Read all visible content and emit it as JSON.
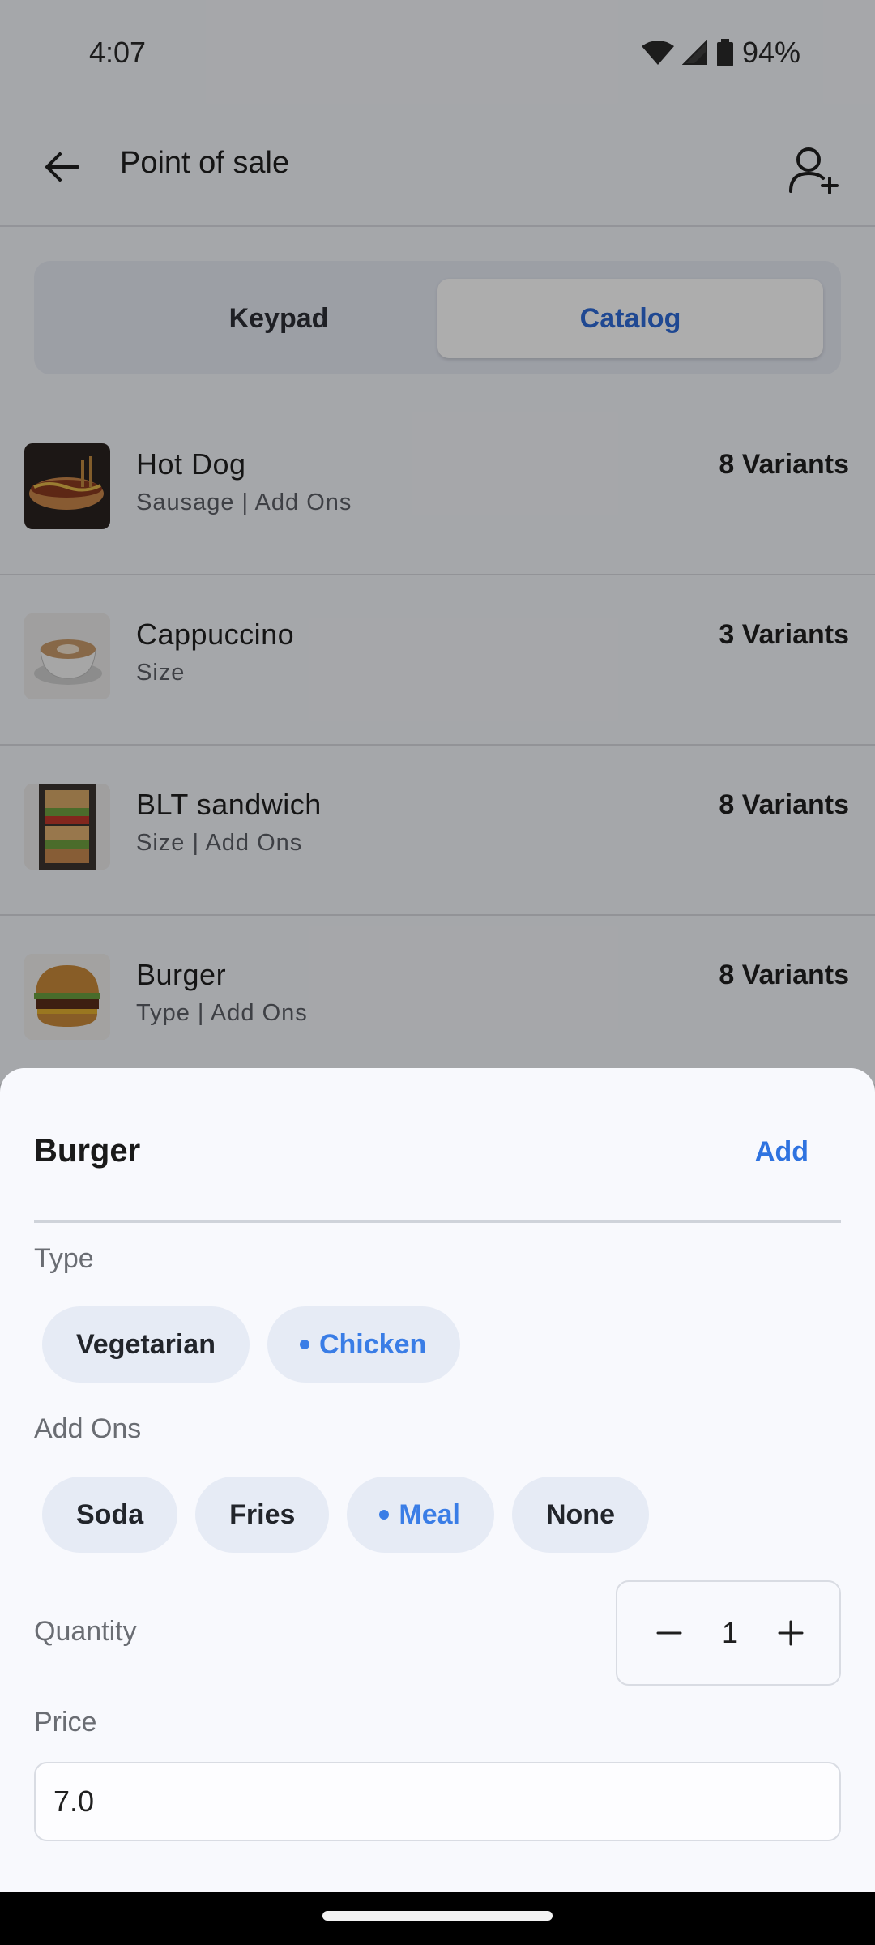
{
  "status_bar": {
    "time": "4:07",
    "battery": "94%"
  },
  "app_bar": {
    "title": "Point of sale"
  },
  "segmented": {
    "keypad_label": "Keypad",
    "catalog_label": "Catalog",
    "selected": "Catalog"
  },
  "catalog": {
    "items": [
      {
        "name": "Hot Dog",
        "subtitle": "Sausage | Add Ons",
        "variants": "8 Variants",
        "icon": "hot-dog-image"
      },
      {
        "name": "Cappuccino",
        "subtitle": "Size",
        "variants": "3 Variants",
        "icon": "cappuccino-image"
      },
      {
        "name": "BLT sandwich",
        "subtitle": "Size | Add Ons",
        "variants": "8 Variants",
        "icon": "sandwich-image"
      },
      {
        "name": "Burger",
        "subtitle": "Type | Add Ons",
        "variants": "8 Variants",
        "icon": "burger-image"
      }
    ]
  },
  "sheet": {
    "title": "Burger",
    "add_label": "Add",
    "type_label": "Type",
    "type_options": [
      "Vegetarian",
      "Chicken"
    ],
    "type_selected": "Chicken",
    "addons_label": "Add Ons",
    "addon_options": [
      "Soda",
      "Fries",
      "Meal",
      "None"
    ],
    "addon_selected": "Meal",
    "quantity_label": "Quantity",
    "quantity_value": "1",
    "price_label": "Price",
    "price_value": "7.0"
  },
  "colors": {
    "accent": "#2f73e0",
    "chip_bg": "#e6ebf5",
    "sheet_bg": "#f8f9fd"
  }
}
